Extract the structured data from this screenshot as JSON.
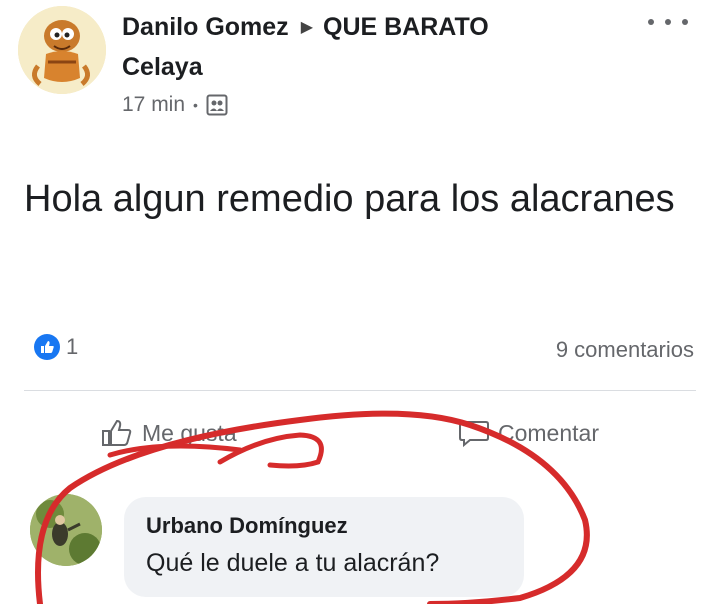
{
  "post": {
    "author": "Danilo Gomez",
    "group_line1": "QUE BARATO",
    "group_line2": "Celaya",
    "time": "17 min",
    "text": "Hola algun remedio para los alacranes"
  },
  "reactions": {
    "like_count": "1",
    "comments_count": "9 comentarios"
  },
  "actions": {
    "like_label": "Me gusta",
    "comment_label": "Comentar"
  },
  "comment": {
    "author": "Urbano Domínguez",
    "text": "Qué le duele a tu alacrán?"
  },
  "colors": {
    "like_blue": "#1877f2",
    "secondary_text": "#65676b",
    "bubble_bg": "#f0f2f5",
    "annotation_red": "#d62b2b"
  },
  "icons": {
    "more": "ellipsis-icon",
    "audience": "group-audience-icon",
    "like_badge": "thumbs-up-icon",
    "like_action": "thumbs-up-outline-icon",
    "comment_action": "speech-bubble-icon"
  }
}
